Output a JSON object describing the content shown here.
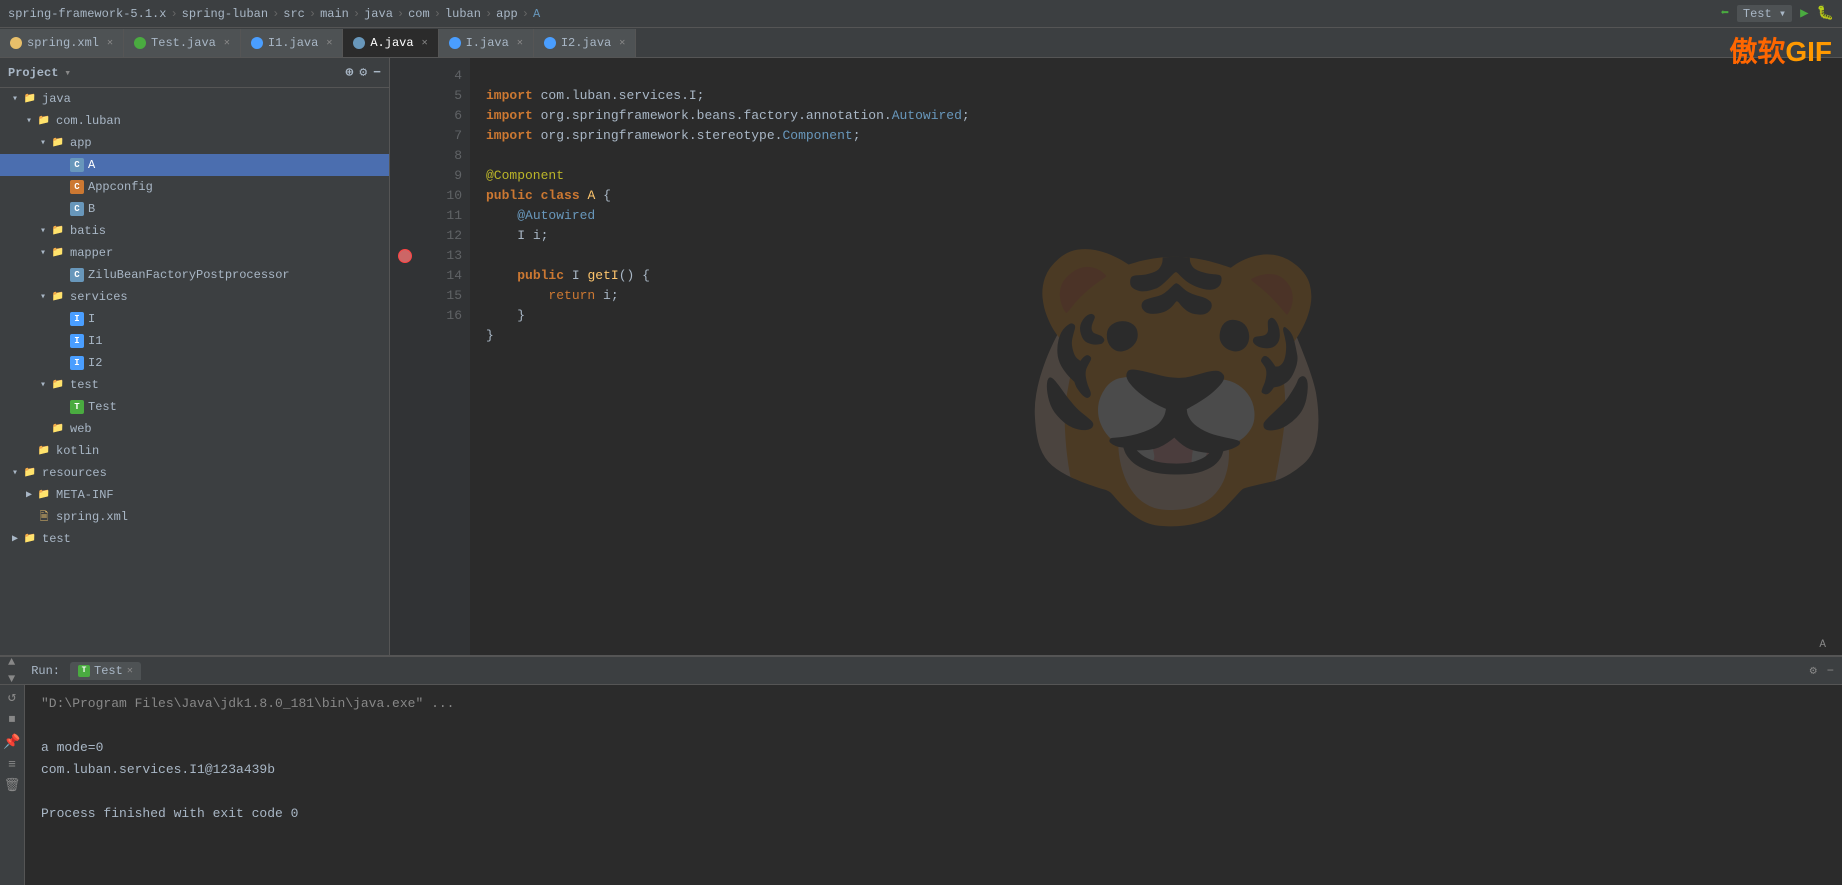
{
  "breadcrumb": {
    "items": [
      "spring-framework-5.1.x",
      "spring-luban",
      "src",
      "main",
      "java",
      "com",
      "luban",
      "app",
      "A"
    ],
    "separator": "›"
  },
  "topbar": {
    "run_button": "▶",
    "debug_button": "🐛",
    "test_label": "Test"
  },
  "watermark": {
    "text1": "傲软",
    "text2": "GIF"
  },
  "tabs": [
    {
      "id": "spring-xml",
      "label": "spring.xml",
      "icon_color": "#e8bf6a",
      "type": "xml",
      "active": false
    },
    {
      "id": "test-java",
      "label": "Test.java",
      "icon_color": "#4aab40",
      "type": "test",
      "active": false
    },
    {
      "id": "i1-java",
      "label": "I1.java",
      "icon_color": "#4a9eff",
      "type": "interface",
      "active": false
    },
    {
      "id": "a-java",
      "label": "A.java",
      "icon_color": "#6897bb",
      "type": "class",
      "active": true
    },
    {
      "id": "i-java",
      "label": "I.java",
      "icon_color": "#4a9eff",
      "type": "interface",
      "active": false
    },
    {
      "id": "i2-java",
      "label": "I2.java",
      "icon_color": "#4a9eff",
      "type": "interface",
      "active": false
    }
  ],
  "sidebar": {
    "header": "Project",
    "tree": [
      {
        "indent": 0,
        "arrow": "▾",
        "icon": "folder",
        "label": "java"
      },
      {
        "indent": 1,
        "arrow": "▾",
        "icon": "folder",
        "label": "com.luban"
      },
      {
        "indent": 2,
        "arrow": "▾",
        "icon": "folder",
        "label": "app",
        "selected": false
      },
      {
        "indent": 3,
        "arrow": "",
        "icon": "class",
        "label": "A",
        "selected": true
      },
      {
        "indent": 3,
        "arrow": "",
        "icon": "appconfig",
        "label": "Appconfig"
      },
      {
        "indent": 3,
        "arrow": "",
        "icon": "class",
        "label": "B"
      },
      {
        "indent": 2,
        "arrow": "▾",
        "icon": "folder",
        "label": "batis"
      },
      {
        "indent": 2,
        "arrow": "▾",
        "icon": "folder",
        "label": "mapper"
      },
      {
        "indent": 3,
        "arrow": "",
        "icon": "class",
        "label": "ZiluBeanFactoryPostprocessor"
      },
      {
        "indent": 2,
        "arrow": "▾",
        "icon": "folder",
        "label": "services"
      },
      {
        "indent": 3,
        "arrow": "",
        "icon": "interface",
        "label": "I"
      },
      {
        "indent": 3,
        "arrow": "",
        "icon": "interface",
        "label": "I1"
      },
      {
        "indent": 3,
        "arrow": "",
        "icon": "interface",
        "label": "I2"
      },
      {
        "indent": 2,
        "arrow": "▾",
        "icon": "folder",
        "label": "test"
      },
      {
        "indent": 3,
        "arrow": "",
        "icon": "test",
        "label": "Test"
      },
      {
        "indent": 2,
        "arrow": "",
        "icon": "folder",
        "label": "web"
      },
      {
        "indent": 1,
        "arrow": "",
        "icon": "folder",
        "label": "kotlin"
      },
      {
        "indent": 0,
        "arrow": "▾",
        "icon": "folder",
        "label": "resources"
      },
      {
        "indent": 1,
        "arrow": "▶",
        "icon": "folder",
        "label": "META-INF"
      },
      {
        "indent": 1,
        "arrow": "",
        "icon": "xml",
        "label": "spring.xml"
      },
      {
        "indent": 0,
        "arrow": "▶",
        "icon": "folder",
        "label": "test"
      }
    ]
  },
  "code": {
    "filename": "A",
    "lines": [
      {
        "num": 4,
        "content": "import_com.luban.services.I;"
      },
      {
        "num": 5,
        "content": "import_org.springframework.beans.factory.annotation.Autowired;"
      },
      {
        "num": 6,
        "content": "import_org.springframework.stereotype.Component;"
      },
      {
        "num": 7,
        "content": ""
      },
      {
        "num": 8,
        "content": "@Component"
      },
      {
        "num": 9,
        "content": "public class A {"
      },
      {
        "num": 10,
        "content": "    @Autowired"
      },
      {
        "num": 11,
        "content": "    I i;"
      },
      {
        "num": 12,
        "content": ""
      },
      {
        "num": 13,
        "content": "    public I getI() {"
      },
      {
        "num": 14,
        "content": "        return i;"
      },
      {
        "num": 15,
        "content": "    }"
      },
      {
        "num": 16,
        "content": "}"
      }
    ]
  },
  "bottom_panel": {
    "run_label": "Run:",
    "tab_label": "Test",
    "console_lines": [
      {
        "text": "\"D:\\Program Files\\Java\\jdk1.8.0_181\\bin\\java.exe\" ...",
        "type": "normal"
      },
      {
        "text": "",
        "type": "normal"
      },
      {
        "text": "a mode=0",
        "type": "normal"
      },
      {
        "text": "com.luban.services.I1@123a439b",
        "type": "normal"
      },
      {
        "text": "",
        "type": "normal"
      },
      {
        "text": "Process finished with exit code 0",
        "type": "normal"
      }
    ]
  }
}
